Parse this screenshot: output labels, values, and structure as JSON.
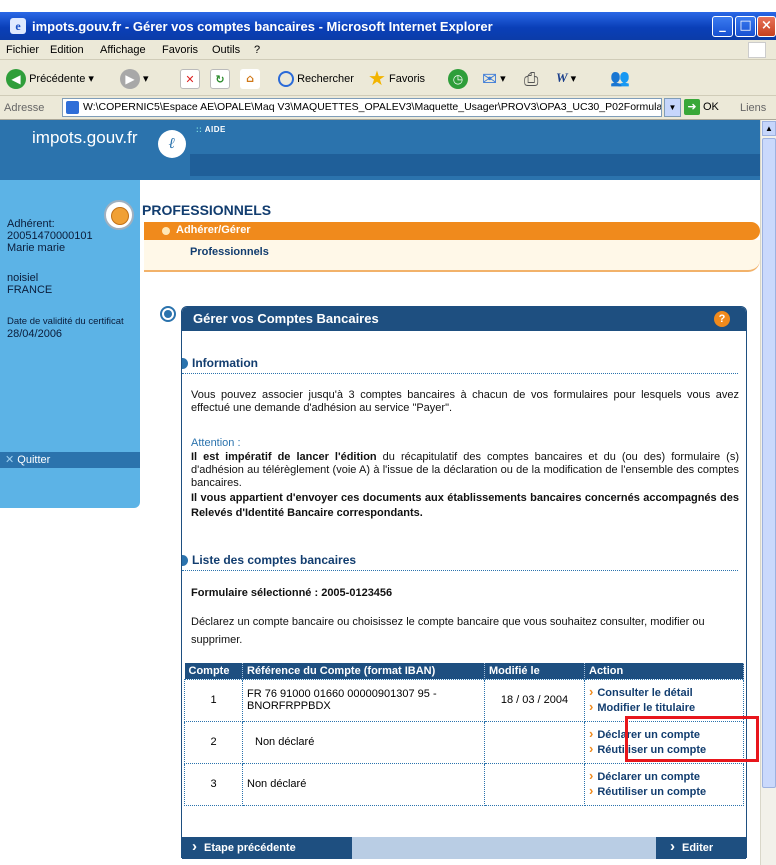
{
  "window": {
    "title": "impots.gouv.fr - Gérer vos comptes bancaires - Microsoft Internet Explorer"
  },
  "menu": [
    "Fichier",
    "Edition",
    "Affichage",
    "Favoris",
    "Outils",
    "?"
  ],
  "toolbar": {
    "back": "Précédente",
    "search": "Rechercher",
    "favorites": "Favoris"
  },
  "address": {
    "label": "Adresse",
    "url": "W:\\COPERNIC5\\Espace AE\\OPALE\\Maq V3\\MAQUETTES_OPALEV3\\Maquette_Usager\\PROV3\\OPA3_UC30_P02Formula",
    "go": "OK",
    "links": "Liens"
  },
  "site": {
    "logo": "impots.gouv.fr",
    "aide": "AIDE"
  },
  "user": {
    "adherent_label": "Adhérent:",
    "id": "20051470000101",
    "name": "Marie marie",
    "city": "noisiel",
    "country": "FRANCE",
    "cert_label": "Date de validité du certificat",
    "cert_date": "28/04/2006",
    "quit": "Quitter"
  },
  "nav": {
    "section": "PROFESSIONNELS",
    "level1": "Adhérer/Gérer",
    "level2": "Professionnels"
  },
  "panel": {
    "title": "Gérer vos Comptes Bancaires",
    "help": "?",
    "info_head": "Information",
    "info_text": "Vous pouvez associer jusqu'à 3 comptes bancaires à chacun de vos formulaires pour lesquels vous avez effectué une demande d'adhésion au service \"Payer\".",
    "attention": "Attention :",
    "warn_bold": "Il est impératif de lancer l'édition",
    "warn_text": " du récapitulatif des comptes bancaires et du (ou des) formulaire (s) d'adhésion au télérèglement (voie A) à l'issue de la déclaration ou de la modification de l'ensemble des comptes bancaires.",
    "warn_bold2": "Il vous appartient d'envoyer ces documents aux établissements bancaires concernés accompagnés des Relevés d'Identité Bancaire correspondants.",
    "list_head": "Liste des comptes bancaires",
    "form_selected": "Formulaire sélectionné : 2005-0123456",
    "instructions": "Déclarez un compte bancaire ou choisissez le compte bancaire que vous souhaitez consulter, modifier ou supprimer."
  },
  "table": {
    "headers": {
      "compte": "Compte",
      "ref": "Référence du Compte (format IBAN)",
      "mod": "Modifié le",
      "action": "Action"
    },
    "rows": [
      {
        "num": "1",
        "ref": "FR 76 91000 01660 00000901307 95 - BNORFRPPBDX",
        "mod": "18 / 03 / 2004",
        "a1": "Consulter le détail",
        "a2": "Modifier le titulaire"
      },
      {
        "num": "2",
        "ref": "Non déclaré",
        "mod": "",
        "a1": "Déclarer un compte",
        "a2": "Réutiliser un compte"
      },
      {
        "num": "3",
        "ref": "Non déclaré",
        "mod": "",
        "a1": "Déclarer un compte",
        "a2": "Réutiliser un compte"
      }
    ]
  },
  "buttons": {
    "prev": "Etape précédente",
    "edit": "Editer"
  }
}
